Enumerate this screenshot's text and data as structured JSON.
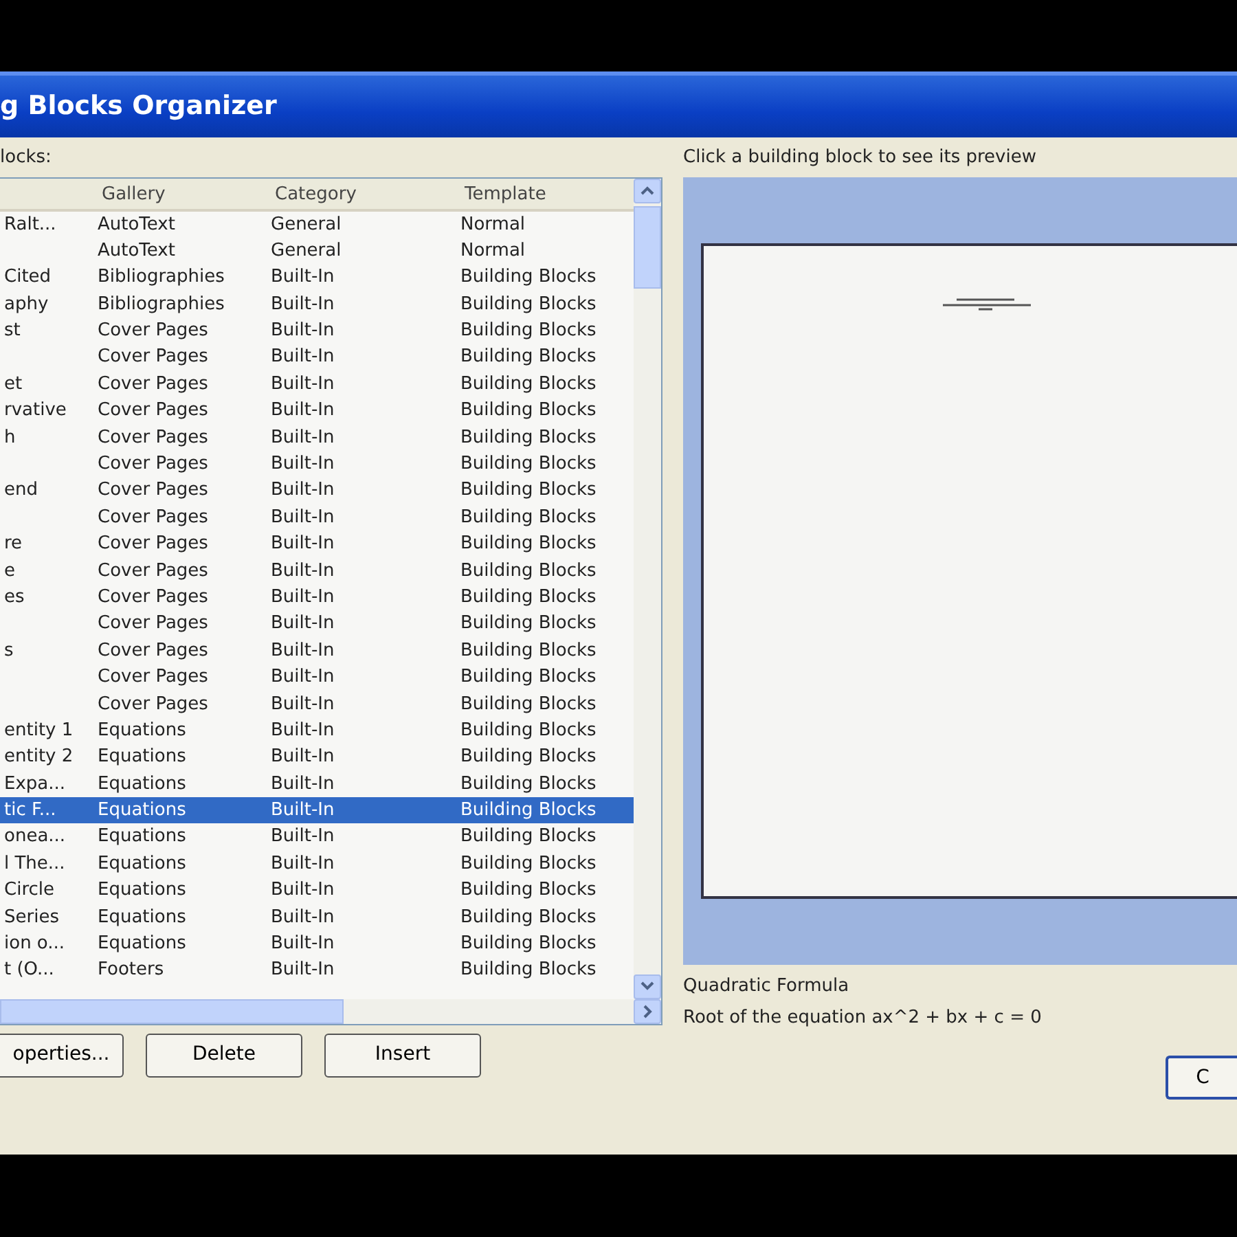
{
  "window": {
    "title": "g Blocks Organizer"
  },
  "list_label": "locks:",
  "table": {
    "columns": [
      {
        "label": "Gallery"
      },
      {
        "label": "Category"
      },
      {
        "label": "Template"
      }
    ],
    "rows": [
      {
        "column_1": "Ralt...",
        "gallery": "AutoText",
        "category": "General",
        "template": "Normal",
        "selected": false
      },
      {
        "gallery": "AutoText",
        "category": "General",
        "template": "Normal",
        "selected": false
      },
      {
        "column_1": "Cited",
        "gallery": "Bibliographies",
        "category": "Built-In",
        "template": "Building Blocks",
        "selected": false
      },
      {
        "column_1": "aphy",
        "gallery": "Bibliographies",
        "category": "Built-In",
        "template": "Building Blocks",
        "selected": false
      },
      {
        "column_1": "st",
        "gallery": "Cover Pages",
        "category": "Built-In",
        "template": "Building Blocks",
        "selected": false
      },
      {
        "gallery": "Cover Pages",
        "category": "Built-In",
        "template": "Building Blocks",
        "selected": false
      },
      {
        "column_1": "et",
        "gallery": "Cover Pages",
        "category": "Built-In",
        "template": "Building Blocks",
        "selected": false
      },
      {
        "column_1": "rvative",
        "gallery": "Cover Pages",
        "category": "Built-In",
        "template": "Building Blocks",
        "selected": false
      },
      {
        "column_1": "h",
        "gallery": "Cover Pages",
        "category": "Built-In",
        "template": "Building Blocks",
        "selected": false
      },
      {
        "gallery": "Cover Pages",
        "category": "Built-In",
        "template": "Building Blocks",
        "selected": false
      },
      {
        "column_1": "end",
        "gallery": "Cover Pages",
        "category": "Built-In",
        "template": "Building Blocks",
        "selected": false
      },
      {
        "gallery": "Cover Pages",
        "category": "Built-In",
        "template": "Building Blocks",
        "selected": false
      },
      {
        "column_1": "re",
        "gallery": "Cover Pages",
        "category": "Built-In",
        "template": "Building Blocks",
        "selected": false
      },
      {
        "column_1": "e",
        "gallery": "Cover Pages",
        "category": "Built-In",
        "template": "Building Blocks",
        "selected": false
      },
      {
        "column_1": "es",
        "gallery": "Cover Pages",
        "category": "Built-In",
        "template": "Building Blocks",
        "selected": false
      },
      {
        "gallery": "Cover Pages",
        "category": "Built-In",
        "template": "Building Blocks",
        "selected": false
      },
      {
        "column_1": "s",
        "gallery": "Cover Pages",
        "category": "Built-In",
        "template": "Building Blocks",
        "selected": false
      },
      {
        "gallery": "Cover Pages",
        "category": "Built-In",
        "template": "Building Blocks",
        "selected": false
      },
      {
        "gallery": "Cover Pages",
        "category": "Built-In",
        "template": "Building Blocks",
        "selected": false
      },
      {
        "column_1": "entity 1",
        "gallery": "Equations",
        "category": "Built-In",
        "template": "Building Blocks",
        "selected": false
      },
      {
        "column_1": "entity 2",
        "gallery": "Equations",
        "category": "Built-In",
        "template": "Building Blocks",
        "selected": false
      },
      {
        "column_1": "Expa...",
        "gallery": "Equations",
        "category": "Built-In",
        "template": "Building Blocks",
        "selected": false
      },
      {
        "column_1": "tic F...",
        "gallery": "Equations",
        "category": "Built-In",
        "template": "Building Blocks",
        "selected": true
      },
      {
        "column_1": "onea...",
        "gallery": "Equations",
        "category": "Built-In",
        "template": "Building Blocks",
        "selected": false
      },
      {
        "column_1": "l The...",
        "gallery": "Equations",
        "category": "Built-In",
        "template": "Building Blocks",
        "selected": false
      },
      {
        "column_1": "Circle",
        "gallery": "Equations",
        "category": "Built-In",
        "template": "Building Blocks",
        "selected": false
      },
      {
        "column_1": "Series",
        "gallery": "Equations",
        "category": "Built-In",
        "template": "Building Blocks",
        "selected": false
      },
      {
        "column_1": "ion o...",
        "gallery": "Equations",
        "category": "Built-In",
        "template": "Building Blocks",
        "selected": false
      },
      {
        "column_1": "t (O...",
        "gallery": "Footers",
        "category": "Built-In",
        "template": "Building Blocks",
        "selected": false
      }
    ]
  },
  "buttons": [
    {
      "label": "operties..."
    },
    {
      "label": "Delete"
    },
    {
      "label": "Insert"
    }
  ],
  "preview": {
    "label": "Click a building block to see its preview",
    "name": "Quadratic Formula",
    "description": "Root of the equation ax^2 + bx + c = 0"
  },
  "close_button": {
    "label": "C"
  }
}
